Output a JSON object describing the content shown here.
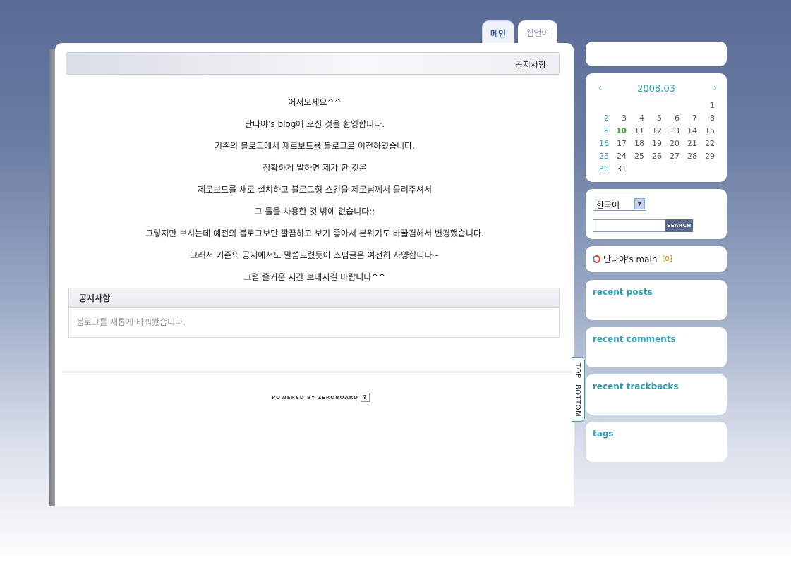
{
  "tabs": [
    {
      "label": "메인"
    },
    {
      "label": "웹언어"
    }
  ],
  "post": {
    "title": "공지사항",
    "lines": [
      "어서오세요^^",
      "난나야's blog에 오신 것을 환영합니다.",
      "기존의 블로그에서 제로보드용 블로그로 이전하였습니다.",
      "정확하게 말하면 제가 한 것은",
      "제로보드를 새로 설치하고 블로그형 스킨을 제로님께서 올려주셔서",
      "그 툴을 사용한 것 밖에 없습니다;;",
      "그렇지만 보시는데 예전의 블로그보단 깔끔하고 보기 좋아서 분위기도 바꿀겸해서 변경했습니다.",
      "그래서 기존의 공지에서도 말씀드렸듯이 스팸글은 여전히 사양합니다~",
      "그럼 즐거운 시간 보내시길 바랍니다^^"
    ]
  },
  "notice": {
    "header": "공지사항",
    "items": [
      "블로그를 새롭게 바꿔봤습니다."
    ]
  },
  "footer": {
    "powered_by": "POWERED BY",
    "brand": "ZEROBOARD",
    "help": "?"
  },
  "scroll": {
    "top": "TOP",
    "bottom": "BOTTOM"
  },
  "calendar": {
    "prev": "‹",
    "next": "›",
    "title": "2008.03",
    "weeks": [
      [
        "",
        "",
        "",
        "",
        "",
        "",
        "1"
      ],
      [
        "2",
        "3",
        "4",
        "5",
        "6",
        "7",
        "8"
      ],
      [
        "9",
        "10",
        "11",
        "12",
        "13",
        "14",
        "15"
      ],
      [
        "16",
        "17",
        "18",
        "19",
        "20",
        "21",
        "22"
      ],
      [
        "23",
        "24",
        "25",
        "26",
        "27",
        "28",
        "29"
      ],
      [
        "30",
        "31",
        "",
        "",
        "",
        "",
        ""
      ]
    ],
    "today": "10"
  },
  "language": {
    "selected": "한국어",
    "arrow": "▼"
  },
  "search": {
    "button": "SEARCH"
  },
  "site": {
    "name": "난나야's main",
    "count": "[0]"
  },
  "sections": {
    "recent_posts": "recent posts",
    "recent_comments": "recent comments",
    "recent_trackbacks": "recent trackbacks",
    "tags": "tags"
  },
  "colors": {
    "accent": "#2f9fb3",
    "today": "#3aa63a",
    "background": "#5a6c96"
  }
}
